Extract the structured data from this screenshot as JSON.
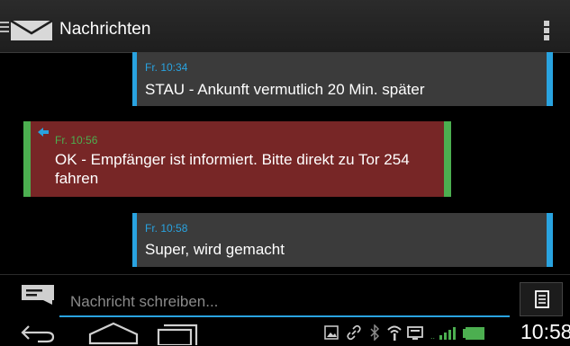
{
  "app": {
    "title": "Nachrichten"
  },
  "messages": [
    {
      "direction": "outgoing",
      "time": "Fr. 10:34",
      "text": "STAU - Ankunft vermutlich 20 Min. später"
    },
    {
      "direction": "incoming",
      "time": "Fr. 10:56",
      "text": "OK - Empfänger ist informiert. Bitte direkt zu Tor 254 fahren"
    },
    {
      "direction": "outgoing",
      "time": "Fr. 10:58",
      "text": "Super, wird gemacht"
    }
  ],
  "composer": {
    "placeholder": "Nachricht schreiben...",
    "value": ""
  },
  "statusbar": {
    "clock": "10:58"
  },
  "colors": {
    "accent": "#29a3e0",
    "incoming_border": "#4caf50",
    "incoming_bg": "#772626",
    "outgoing_bg": "#3b3b3b"
  },
  "icons": [
    "menu-icon",
    "mail-icon",
    "overflow-menu-icon",
    "compose-icon",
    "send-icon",
    "back-icon",
    "home-icon",
    "recent-apps-icon",
    "image-icon",
    "link-icon",
    "bluetooth-icon",
    "wifi-icon",
    "notification-icon",
    "signal-icon",
    "battery-icon"
  ]
}
